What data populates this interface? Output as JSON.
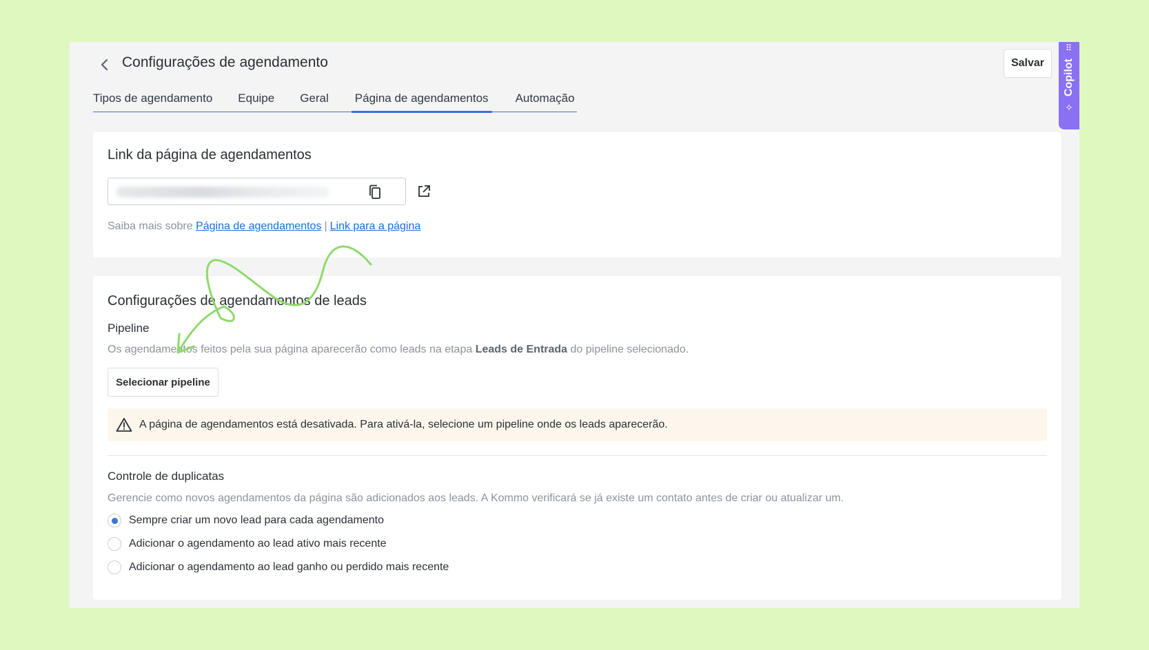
{
  "header": {
    "title": "Configurações de agendamento",
    "save_label": "Salvar"
  },
  "tabs": [
    {
      "label": "Tipos de agendamento",
      "active": false
    },
    {
      "label": "Equipe",
      "active": false
    },
    {
      "label": "Geral",
      "active": false
    },
    {
      "label": "Página de agendamentos",
      "active": true
    },
    {
      "label": "Automação",
      "active": false
    }
  ],
  "copilot": {
    "label": "Copilot"
  },
  "link_section": {
    "title": "Link da página de agendamentos",
    "help_prefix": "Saiba mais sobre",
    "help_link_1": "Página de agendamentos",
    "help_separator": "|",
    "help_link_2": "Link para a página"
  },
  "leads_section": {
    "title": "Configurações de agendamentos de leads",
    "pipeline_label": "Pipeline",
    "pipeline_desc_prefix": "Os agendamentos feitos pela sua página aparecerão como leads na etapa",
    "pipeline_desc_bold": "Leads de Entrada",
    "pipeline_desc_suffix": "do pipeline selecionado.",
    "select_pipeline_label": "Selecionar pipeline",
    "warning_text": "A página de agendamentos está desativada. Para ativá-la, selecione um pipeline onde os leads aparecerão.",
    "duplicates_label": "Controle de duplicatas",
    "duplicates_desc": "Gerencie como novos agendamentos da página são adicionados aos leads. A Kommo verificará se já existe um contato antes de criar ou atualizar um.",
    "options": [
      {
        "label": "Sempre criar um novo lead para cada agendamento",
        "checked": true
      },
      {
        "label": "Adicionar o agendamento ao lead ativo mais recente",
        "checked": false
      },
      {
        "label": "Adicionar o agendamento ao lead ganho ou perdido mais recente",
        "checked": false
      }
    ]
  },
  "colors": {
    "background": "#dff8bf",
    "accent": "#3d72d6",
    "link": "#1d6ad9",
    "copilot": "#8a70f2",
    "annotation": "#8fd96b"
  }
}
